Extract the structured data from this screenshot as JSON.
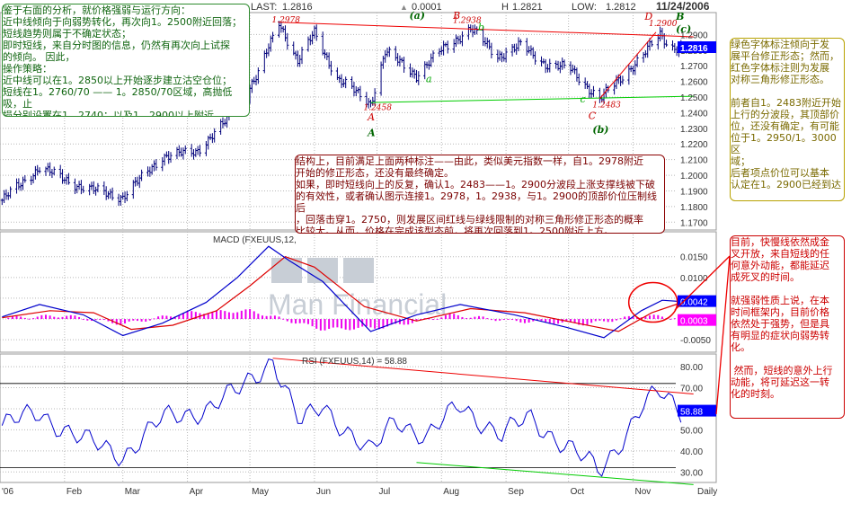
{
  "header": {
    "last_label": "LAST:",
    "last_value": "1.2816",
    "change_value": "0.0001",
    "high_label": "H",
    "high_value": "1.2821",
    "low_label": "LOW:",
    "low_value": "1.2812",
    "date_fragment": "11/24/2006"
  },
  "colors": {
    "price_bar": "#00007a",
    "macd_line": "#0000cc",
    "signal_line": "#dd0000",
    "histogram": "#ee00ee",
    "rsi_line": "#0000cc",
    "red_trend": "#ee0000",
    "green_trend": "#00cc00",
    "grid": "#b8b8b8",
    "label_price_bg": "#0000ff",
    "label_macd_bg": "#0000ff",
    "label_signal_bg": "#ff00ff",
    "watermark": "#c8ced6"
  },
  "watermark_text": "Man Financial",
  "chart_data": [
    {
      "type": "line",
      "panel": "price",
      "display": "daily OHLC bars",
      "x_labels": [
        "'06",
        "Feb",
        "Mar",
        "Apr",
        "May",
        "Jun",
        "Jul",
        "Aug",
        "Sep",
        "Oct",
        "Nov",
        "Daily"
      ],
      "ylim": [
        1.165,
        1.304
      ],
      "yticks": [
        1.17,
        1.18,
        1.19,
        1.2,
        1.21,
        1.22,
        1.23,
        1.24,
        1.25,
        1.26,
        1.27,
        1.28,
        1.29
      ],
      "ytick_labels": [
        "1.1700",
        "1.1800",
        "1.1900",
        "1.2000",
        "1.2100",
        "1.2200",
        "1.2300",
        "1.2400",
        "1.2500",
        "1.2600",
        "1.2700",
        "1.2800",
        "1.2900"
      ],
      "last_label": "1.2816",
      "key_points": [
        {
          "x": "2006-01-02",
          "y": 1.184
        },
        {
          "x": "2006-01-20",
          "y": 1.205
        },
        {
          "x": "2006-02-10",
          "y": 1.192
        },
        {
          "x": "2006-03-01",
          "y": 1.186
        },
        {
          "x": "2006-03-20",
          "y": 1.212
        },
        {
          "x": "2006-04-05",
          "y": 1.215
        },
        {
          "x": "2006-04-20",
          "y": 1.235
        },
        {
          "x": "2006-05-05",
          "y": 1.265
        },
        {
          "x": "2006-05-15",
          "y": 1.2978
        },
        {
          "x": "2006-05-24",
          "y": 1.273
        },
        {
          "x": "2006-06-01",
          "y": 1.291
        },
        {
          "x": "2006-06-12",
          "y": 1.262
        },
        {
          "x": "2006-06-28",
          "y": 1.2458
        },
        {
          "x": "2006-07-05",
          "y": 1.279
        },
        {
          "x": "2006-07-20",
          "y": 1.264
        },
        {
          "x": "2006-08-01",
          "y": 1.28
        },
        {
          "x": "2006-08-15",
          "y": 1.2938
        },
        {
          "x": "2006-08-28",
          "y": 1.276
        },
        {
          "x": "2006-09-08",
          "y": 1.283
        },
        {
          "x": "2006-09-20",
          "y": 1.271
        },
        {
          "x": "2006-10-02",
          "y": 1.268
        },
        {
          "x": "2006-10-16",
          "y": 1.2483
        },
        {
          "x": "2006-10-26",
          "y": 1.262
        },
        {
          "x": "2006-11-06",
          "y": 1.277
        },
        {
          "x": "2006-11-14",
          "y": 1.29
        },
        {
          "x": "2006-11-19",
          "y": 1.282
        },
        {
          "x": "2006-11-24",
          "y": 1.2816
        }
      ],
      "annotations": [
        {
          "text": "1.2978",
          "x": "2006-05-15",
          "y": 1.2978,
          "color": "#cc0000"
        },
        {
          "text": "(a)",
          "x": "2006-07-20",
          "y": 1.3,
          "color": "#006600"
        },
        {
          "text": "B",
          "x": "2006-08-10",
          "y": 1.3,
          "color": "#cc0000"
        },
        {
          "text": "1.2938",
          "x": "2006-08-10",
          "y": 1.2975,
          "color": "#cc0000"
        },
        {
          "text": "b",
          "x": "2006-08-22",
          "y": 1.2925,
          "color": "#00aa00"
        },
        {
          "text": "a",
          "x": "2006-07-28",
          "y": 1.2595,
          "color": "#00aa00"
        },
        {
          "text": "1.2458",
          "x": "2006-06-28",
          "y": 1.2417,
          "color": "#cc0000"
        },
        {
          "text": "A",
          "x": "2006-06-30",
          "y": 1.235,
          "color": "#cc0000"
        },
        {
          "text": "A",
          "x": "2006-06-30",
          "y": 1.225,
          "color": "#006600"
        },
        {
          "text": "c",
          "x": "2006-10-10",
          "y": 1.2465,
          "color": "#00aa00"
        },
        {
          "text": "1.2483",
          "x": "2006-10-16",
          "y": 1.2435,
          "color": "#cc0000"
        },
        {
          "text": "C",
          "x": "2006-10-14",
          "y": 1.236,
          "color": "#cc0000"
        },
        {
          "text": "(b)",
          "x": "2006-10-16",
          "y": 1.227,
          "color": "#006600"
        },
        {
          "text": "D",
          "x": "2006-11-10",
          "y": 1.2995,
          "color": "#cc0000"
        },
        {
          "text": "1.2900",
          "x": "2006-11-12",
          "y": 1.2953,
          "color": "#cc0000"
        },
        {
          "text": "B",
          "x": "2006-11-25",
          "y": 1.2995,
          "color": "#006600"
        },
        {
          "text": "(c)",
          "x": "2006-11-25",
          "y": 1.2915,
          "color": "#006600"
        }
      ],
      "trendlines": [
        {
          "color": "red",
          "from": {
            "x": "2006-05-15",
            "y": 1.2978
          },
          "to": {
            "x": "2006-11-30",
            "y": 1.2885
          }
        },
        {
          "color": "green",
          "from": {
            "x": "2006-06-28",
            "y": 1.2465
          },
          "to": {
            "x": "2006-11-30",
            "y": 1.2505
          }
        },
        {
          "color": "red",
          "from": {
            "x": "2006-10-16",
            "y": 1.249
          },
          "to": {
            "x": "2006-11-12",
            "y": 1.2915
          }
        }
      ]
    },
    {
      "type": "line",
      "panel": "macd",
      "title": "MACD (FXEUUS,12,",
      "ylim": [
        -0.008,
        0.021
      ],
      "yticks": [
        -0.005,
        0.0,
        0.005,
        0.01,
        0.015
      ],
      "ytick_labels": [
        "-0.0050",
        "0.0000",
        "0.0050",
        "0.0100",
        "0.0150"
      ],
      "last_labels": [
        "0.0042",
        "0.0003"
      ],
      "series": [
        {
          "role": "macd",
          "points": [
            {
              "x": "2006-01-02",
              "y": 0.0005
            },
            {
              "x": "2006-01-20",
              "y": 0.0035
            },
            {
              "x": "2006-02-10",
              "y": 0.001
            },
            {
              "x": "2006-03-01",
              "y": -0.004
            },
            {
              "x": "2006-03-20",
              "y": -0.001
            },
            {
              "x": "2006-04-10",
              "y": 0.004
            },
            {
              "x": "2006-04-25",
              "y": 0.01
            },
            {
              "x": "2006-05-10",
              "y": 0.0175
            },
            {
              "x": "2006-05-20",
              "y": 0.014
            },
            {
              "x": "2006-06-05",
              "y": 0.009
            },
            {
              "x": "2006-06-28",
              "y": -0.003
            },
            {
              "x": "2006-07-20",
              "y": 0.001
            },
            {
              "x": "2006-08-10",
              "y": 0.0035
            },
            {
              "x": "2006-09-05",
              "y": 0.001
            },
            {
              "x": "2006-09-30",
              "y": -0.002
            },
            {
              "x": "2006-10-18",
              "y": -0.0045
            },
            {
              "x": "2006-11-05",
              "y": 0.002
            },
            {
              "x": "2006-11-15",
              "y": 0.0045
            },
            {
              "x": "2006-11-24",
              "y": 0.0042
            }
          ]
        },
        {
          "role": "signal",
          "points": [
            {
              "x": "2006-01-02",
              "y": 0.0003
            },
            {
              "x": "2006-01-25",
              "y": 0.002
            },
            {
              "x": "2006-02-15",
              "y": 0.0015
            },
            {
              "x": "2006-03-05",
              "y": -0.0025
            },
            {
              "x": "2006-03-25",
              "y": -0.0015
            },
            {
              "x": "2006-04-15",
              "y": 0.002
            },
            {
              "x": "2006-05-01",
              "y": 0.008
            },
            {
              "x": "2006-05-18",
              "y": 0.015
            },
            {
              "x": "2006-06-01",
              "y": 0.0125
            },
            {
              "x": "2006-06-25",
              "y": 0.003
            },
            {
              "x": "2006-07-20",
              "y": -0.0005
            },
            {
              "x": "2006-08-15",
              "y": 0.0025
            },
            {
              "x": "2006-09-10",
              "y": 0.0015
            },
            {
              "x": "2006-10-05",
              "y": -0.001
            },
            {
              "x": "2006-10-25",
              "y": -0.003
            },
            {
              "x": "2006-11-10",
              "y": 0.0015
            },
            {
              "x": "2006-11-24",
              "y": 0.0039
            }
          ]
        },
        {
          "role": "histogram",
          "points": [
            {
              "x": "2006-01-02",
              "y": 0.0002
            },
            {
              "x": "2006-02-01",
              "y": 0.0008
            },
            {
              "x": "2006-03-01",
              "y": -0.0012
            },
            {
              "x": "2006-04-01",
              "y": 0.0015
            },
            {
              "x": "2006-05-01",
              "y": 0.002
            },
            {
              "x": "2006-06-05",
              "y": -0.0025
            },
            {
              "x": "2006-07-05",
              "y": -0.002
            },
            {
              "x": "2006-08-05",
              "y": 0.001
            },
            {
              "x": "2006-09-05",
              "y": -0.0005
            },
            {
              "x": "2006-10-10",
              "y": -0.0012
            },
            {
              "x": "2006-11-05",
              "y": 0.0008
            },
            {
              "x": "2006-11-24",
              "y": 0.0003
            }
          ]
        }
      ]
    },
    {
      "type": "line",
      "panel": "rsi",
      "title": "RSI (FXEUUS,14) = 58.88",
      "ylim": [
        25,
        86
      ],
      "yticks": [
        30,
        40,
        50,
        60,
        70,
        80
      ],
      "ytick_labels": [
        "30.00",
        "40.00",
        "50.00",
        "60.00",
        "70.00",
        "80.00"
      ],
      "last_label": "58.88",
      "points": [
        {
          "x": "2006-01-02",
          "y": 52
        },
        {
          "x": "2006-01-20",
          "y": 58
        },
        {
          "x": "2006-02-10",
          "y": 45
        },
        {
          "x": "2006-03-01",
          "y": 38
        },
        {
          "x": "2006-03-20",
          "y": 55
        },
        {
          "x": "2006-04-10",
          "y": 60
        },
        {
          "x": "2006-04-25",
          "y": 68
        },
        {
          "x": "2006-05-12",
          "y": 84
        },
        {
          "x": "2006-05-25",
          "y": 52
        },
        {
          "x": "2006-06-05",
          "y": 62
        },
        {
          "x": "2006-06-28",
          "y": 38
        },
        {
          "x": "2006-07-10",
          "y": 56
        },
        {
          "x": "2006-07-25",
          "y": 46
        },
        {
          "x": "2006-08-10",
          "y": 62
        },
        {
          "x": "2006-08-30",
          "y": 47
        },
        {
          "x": "2006-09-12",
          "y": 56
        },
        {
          "x": "2006-09-28",
          "y": 44
        },
        {
          "x": "2006-10-16",
          "y": 30
        },
        {
          "x": "2006-10-26",
          "y": 45
        },
        {
          "x": "2006-11-06",
          "y": 62
        },
        {
          "x": "2006-11-14",
          "y": 67
        },
        {
          "x": "2006-11-24",
          "y": 58.88
        }
      ],
      "reference_lines": [
        72,
        32
      ],
      "trendlines": [
        {
          "color": "red",
          "from": {
            "x": "2006-05-12",
            "y": 84
          },
          "to": {
            "x": "2006-11-30",
            "y": 67
          }
        },
        {
          "color": "green",
          "from": {
            "x": "2006-07-20",
            "y": 34.5
          },
          "to": {
            "x": "2006-11-30",
            "y": 24
          }
        }
      ],
      "highlight": {
        "x": "2006-11-08",
        "y": 0.004,
        "panel": "macd",
        "color": "#ee0000"
      }
    }
  ],
  "notes": [
    {
      "key": "top_left",
      "text": "鉴于右面的分析，就价格强弱与运行方向：\n近中线倾向于向弱势转化，再次向1。2500附近回落；\n短线趋势则属于不确定状态；\n即时短线，来自分时图的信息，仍然有再次向上试探\n的倾向。 因此，\n操作策略：\n近中线可以在1。2850以上开始逐步建立沽空仓位；\n短线在1。2760/70 —— 1。2850/70区域，高抛低吸，止\n损分别设置在1。2740；以及1。2900以上附近。"
    },
    {
      "key": "center",
      "text": "结构上，目前满足上面两种标注——由此，类似美元指数一样，自1。2978附近\n开始的修正形态，还没有最终确定。\n如果，即时短线向上的反复，确认1。2483——1。2900分波段上涨支撑线被下破\n的有效性，或者确认图示连接1。2978，1。2938，与1。2900的顶部价位压制线后\n，回落击穿1。2750，则发展区间红线与绿线限制的对称三角形修正形态的概率\n比较大。从而，价格在完成该型态前，将再次回落到1。2500附近上方。"
    },
    {
      "key": "right_top",
      "text": "绿色字体标注倾向于发\n展平台修正形态；然而，\n红色字体标注则为发展\n对称三角形修正形态。\n\n前者自1。2483附近开始\n上行的分波段，其顶部价\n位，还没有确定，有可能\n位于1。2950/1。3000区\n域；\n后者项点价位可以基本\n认定在1。2900已经到达"
    },
    {
      "key": "right_bottom",
      "text": "目前，快慢线依然成金\n叉开放，来自短线的任\n何意外动能，都能延迟\n成死叉的时间。\n\n就强弱性质上说，在本\n时间框架内，目前价格\n依然处于强势，但是具\n有明显的症状向弱势转\n化。\n\n 然而，短线的意外上行\n动能，将可延迟这一转\n化的时刻。"
    }
  ]
}
